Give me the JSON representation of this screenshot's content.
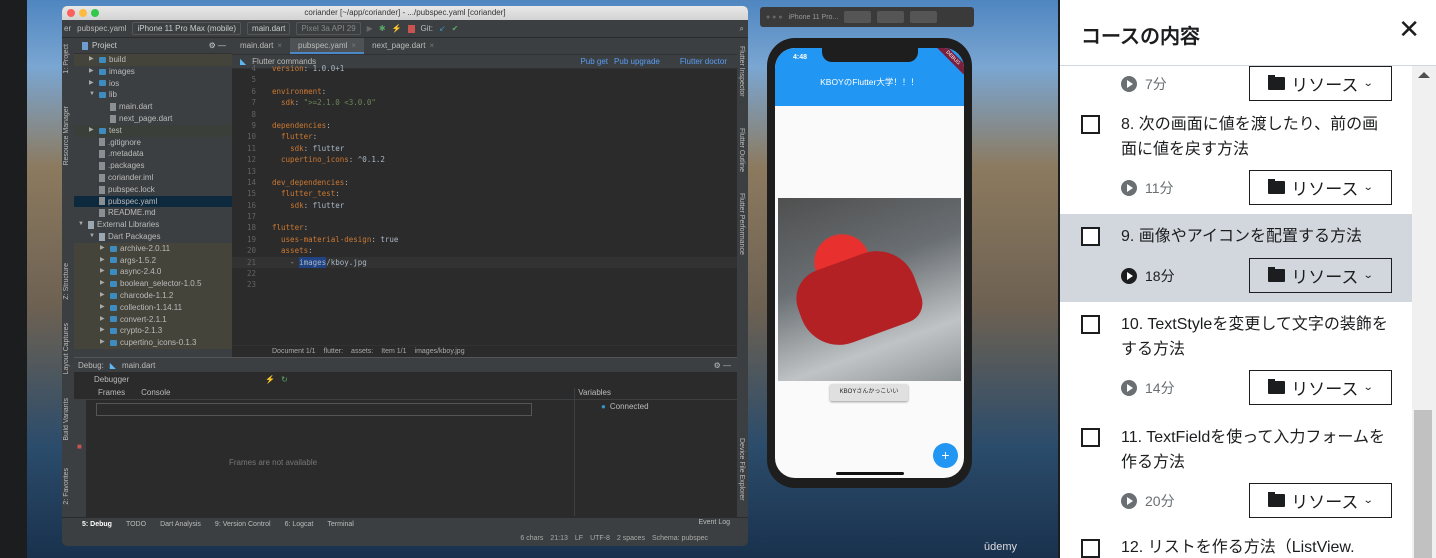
{
  "ide": {
    "window_title": "coriander [~/app/coriander] - .../pubspec.yaml [coriander]",
    "toolbar": {
      "breadcrumb_prefix": "er",
      "file": "pubspec.yaml",
      "device": "iPhone 11 Pro Max (mobile)",
      "run_config": "main.dart",
      "emulator": "Pixel 3a API 29",
      "git_label": "Git:"
    },
    "left_strip": [
      "1: Project",
      "Resource Manager",
      "Z: Structure",
      "Layout Captures",
      "Build Variants",
      "2: Favorites"
    ],
    "right_strip": [
      "Flutter Inspector",
      "Flutter Outline",
      "Flutter Performance",
      "Device File Explorer"
    ],
    "project": {
      "title": "Project",
      "tree": [
        {
          "label": "build",
          "depth": 1,
          "type": "folder",
          "hl": "hl"
        },
        {
          "label": "images",
          "depth": 1,
          "type": "folder"
        },
        {
          "label": "ios",
          "depth": 1,
          "type": "folder"
        },
        {
          "label": "lib",
          "depth": 1,
          "type": "folder",
          "open": true
        },
        {
          "label": "main.dart",
          "depth": 2,
          "type": "file"
        },
        {
          "label": "next_page.dart",
          "depth": 2,
          "type": "file"
        },
        {
          "label": "test",
          "depth": 1,
          "type": "folder",
          "hl": "hlb"
        },
        {
          "label": ".gitignore",
          "depth": 1,
          "type": "file",
          "leaf": true
        },
        {
          "label": ".metadata",
          "depth": 1,
          "type": "file",
          "leaf": true
        },
        {
          "label": ".packages",
          "depth": 1,
          "type": "file",
          "leaf": true
        },
        {
          "label": "coriander.iml",
          "depth": 1,
          "type": "file",
          "leaf": true
        },
        {
          "label": "pubspec.lock",
          "depth": 1,
          "type": "file",
          "leaf": true
        },
        {
          "label": "pubspec.yaml",
          "depth": 1,
          "type": "file",
          "leaf": true,
          "hl": "sel"
        },
        {
          "label": "README.md",
          "depth": 1,
          "type": "file",
          "leaf": true
        },
        {
          "label": "External Libraries",
          "depth": 0,
          "type": "lib",
          "open": true
        },
        {
          "label": "Dart Packages",
          "depth": 1,
          "type": "lib",
          "open": true
        },
        {
          "label": "archive-2.0.11",
          "depth": 2,
          "type": "folder",
          "hl": "hl"
        },
        {
          "label": "args-1.5.2",
          "depth": 2,
          "type": "folder",
          "hl": "hl"
        },
        {
          "label": "async-2.4.0",
          "depth": 2,
          "type": "folder",
          "hl": "hl"
        },
        {
          "label": "boolean_selector-1.0.5",
          "depth": 2,
          "type": "folder",
          "hl": "hl"
        },
        {
          "label": "charcode-1.1.2",
          "depth": 2,
          "type": "folder",
          "hl": "hl"
        },
        {
          "label": "collection-1.14.11",
          "depth": 2,
          "type": "folder",
          "hl": "hl"
        },
        {
          "label": "convert-2.1.1",
          "depth": 2,
          "type": "folder",
          "hl": "hl"
        },
        {
          "label": "crypto-2.1.3",
          "depth": 2,
          "type": "folder",
          "hl": "hl"
        },
        {
          "label": "cupertino_icons-0.1.3",
          "depth": 2,
          "type": "folder",
          "hl": "hl"
        }
      ]
    },
    "tabs": [
      {
        "label": "main.dart"
      },
      {
        "label": "pubspec.yaml",
        "active": true
      },
      {
        "label": "next_page.dart"
      }
    ],
    "flutter_commands": {
      "title": "Flutter commands",
      "pub_get": "Pub get",
      "pub_upgrade": "Pub upgrade",
      "flutter_doctor": "Flutter doctor"
    },
    "code": [
      {
        "n": "4",
        "parts": [
          [
            "k",
            "version"
          ],
          [
            "t",
            ": 1.0.0+1"
          ]
        ]
      },
      {
        "n": "5",
        "parts": []
      },
      {
        "n": "6",
        "parts": [
          [
            "k",
            "environment"
          ],
          [
            "t",
            ":"
          ]
        ]
      },
      {
        "n": "7",
        "parts": [
          [
            "t",
            "  "
          ],
          [
            "k",
            "sdk"
          ],
          [
            "t",
            ": "
          ],
          [
            "s",
            "\">=2.1.0 <3.0.0\""
          ]
        ]
      },
      {
        "n": "8",
        "parts": []
      },
      {
        "n": "9",
        "parts": [
          [
            "k",
            "dependencies"
          ],
          [
            "t",
            ":"
          ]
        ]
      },
      {
        "n": "10",
        "parts": [
          [
            "t",
            "  "
          ],
          [
            "k",
            "flutter"
          ],
          [
            "t",
            ":"
          ]
        ]
      },
      {
        "n": "11",
        "parts": [
          [
            "t",
            "    "
          ],
          [
            "k",
            "sdk"
          ],
          [
            "t",
            ": flutter"
          ]
        ]
      },
      {
        "n": "12",
        "parts": [
          [
            "t",
            "  "
          ],
          [
            "k",
            "cupertino_icons"
          ],
          [
            "t",
            ": ^0.1.2"
          ]
        ]
      },
      {
        "n": "13",
        "parts": []
      },
      {
        "n": "14",
        "parts": [
          [
            "k",
            "dev_dependencies"
          ],
          [
            "t",
            ":"
          ]
        ]
      },
      {
        "n": "15",
        "parts": [
          [
            "t",
            "  "
          ],
          [
            "k",
            "flutter_test"
          ],
          [
            "t",
            ":"
          ]
        ]
      },
      {
        "n": "16",
        "parts": [
          [
            "t",
            "    "
          ],
          [
            "k",
            "sdk"
          ],
          [
            "t",
            ": flutter"
          ]
        ]
      },
      {
        "n": "17",
        "parts": []
      },
      {
        "n": "18",
        "parts": [
          [
            "k",
            "flutter"
          ],
          [
            "t",
            ":"
          ]
        ]
      },
      {
        "n": "19",
        "parts": [
          [
            "t",
            "  "
          ],
          [
            "k",
            "uses-material-design"
          ],
          [
            "t",
            ": true"
          ]
        ]
      },
      {
        "n": "20",
        "parts": [
          [
            "t",
            "  "
          ],
          [
            "k",
            "assets"
          ],
          [
            "t",
            ":"
          ]
        ]
      },
      {
        "n": "21",
        "cur": true,
        "parts": [
          [
            "t",
            "    - "
          ],
          [
            "sel",
            "images"
          ],
          [
            "t",
            "/kboy.jpg"
          ]
        ]
      },
      {
        "n": "22",
        "parts": []
      },
      {
        "n": "23",
        "parts": []
      }
    ],
    "editor_breadcrumb": [
      "Document 1/1",
      "flutter:",
      "assets:",
      "Item 1/1",
      "images/kboy.jpg"
    ],
    "debug": {
      "label": "Debug:",
      "tab": "main.dart",
      "debugger": "Debugger",
      "frames": "Frames",
      "console": "Console",
      "variables": "Variables",
      "connected": "Connected",
      "empty": "Frames are not available"
    },
    "bottom_tabs": [
      "5: Debug",
      "TODO",
      "Dart Analysis",
      "9: Version Control",
      "6: Logcat",
      "Terminal"
    ],
    "event_log": "Event Log",
    "status": [
      "6 chars",
      "21:13",
      "LF",
      "UTF-8",
      "2 spaces",
      "Schema: pubspec"
    ]
  },
  "simulator": {
    "title": "iPhone 11 Pro...",
    "time": "4:48",
    "debug_banner": "DEBUG",
    "app_title": "KBOYのFlutter大学！！！",
    "button": "KBOYさんかっこいい",
    "fab": "+"
  },
  "watermark": "ūdemy",
  "sidebar": {
    "title": "コースの内容",
    "close": "✕",
    "resource_label": "リソース",
    "items": [
      {
        "title": "",
        "duration": "7分",
        "partial": true
      },
      {
        "title": "8. 次の画面に値を渡したり、前の画面に値を戻す方法",
        "duration": "11分"
      },
      {
        "title": "9. 画像やアイコンを配置する方法",
        "duration": "18分",
        "current": true
      },
      {
        "title": "10. TextStyleを変更して文字の装飾をする方法",
        "duration": "14分"
      },
      {
        "title": "11. TextFieldを使って入力フォームを作る方法",
        "duration": "20分"
      },
      {
        "title": "12. リストを作る方法（ListView.",
        "duration": "",
        "partial": true
      }
    ]
  }
}
